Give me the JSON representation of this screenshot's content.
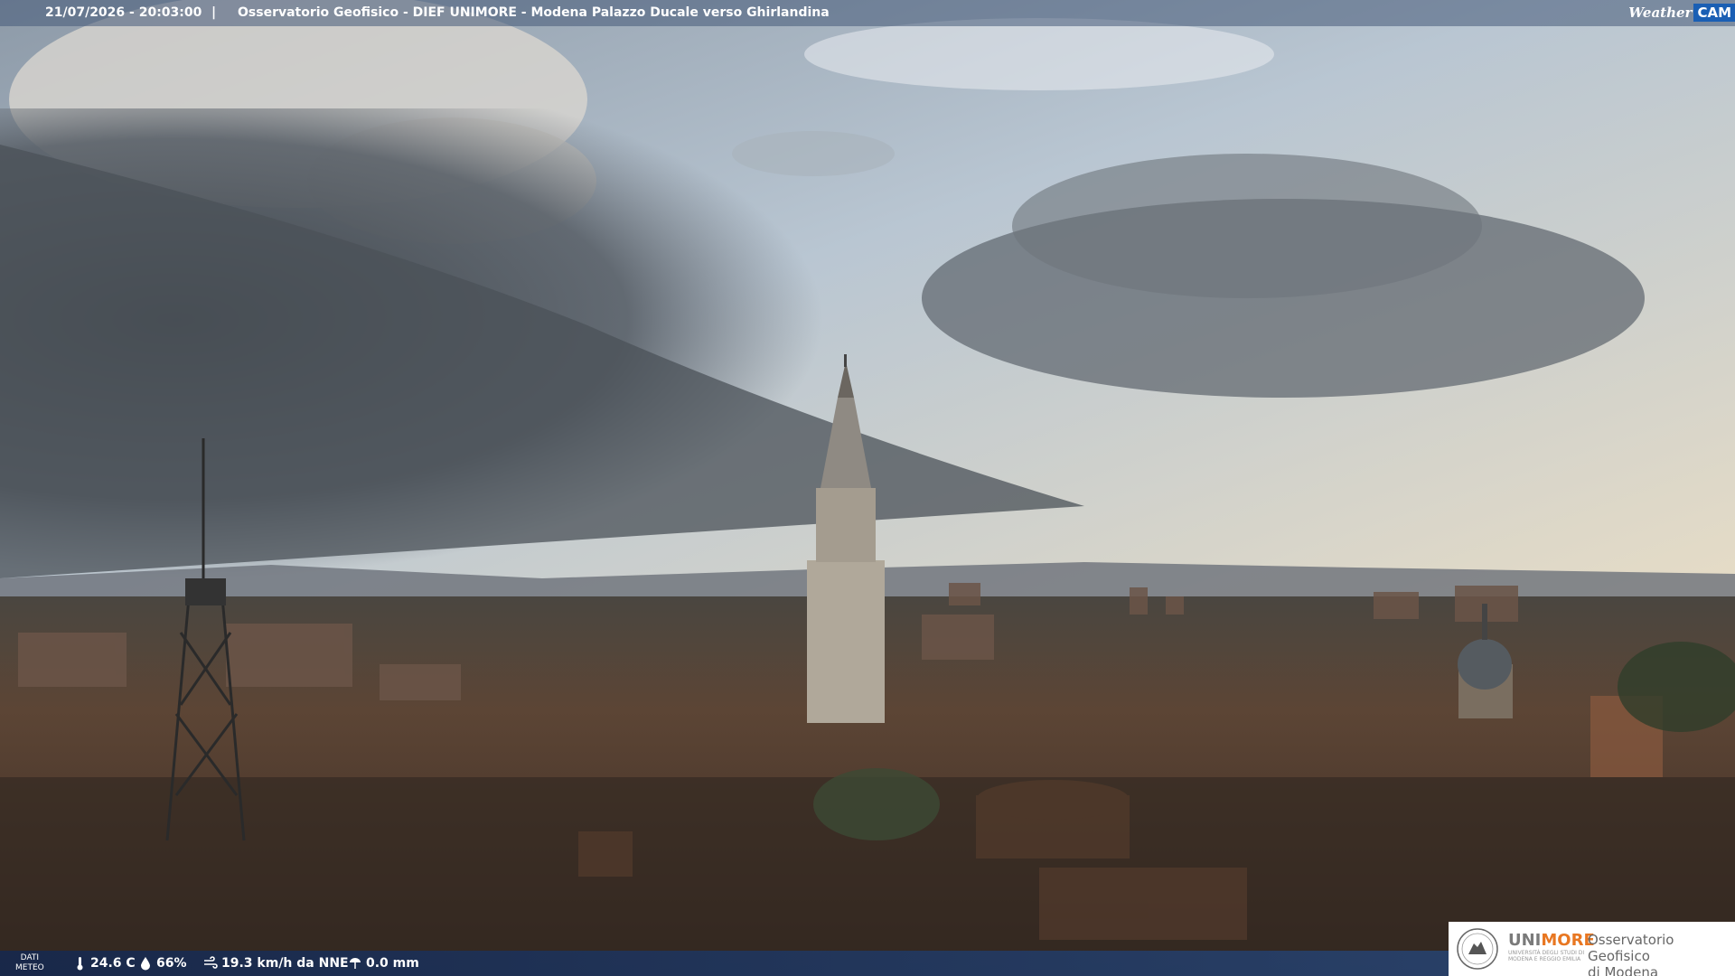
{
  "header": {
    "datetime": "21/07/2026 - 20:03:00",
    "separator": "|",
    "title": "Osservatorio Geofisico - DIEF UNIMORE - Modena Palazzo Ducale verso Ghirlandina",
    "brand_weather": "Weather",
    "brand_cam": "CAM"
  },
  "weather": {
    "label_line1": "DATI",
    "label_line2": "METEO",
    "temperature": "24.6 C",
    "humidity": "66%",
    "wind": "19.3 km/h da NNE",
    "rain": "0.0 mm"
  },
  "logo": {
    "uni_part1": "UNI",
    "uni_part2": "MORE",
    "uni_sub1": "UNIVERSITÀ DEGLI STUDI DI",
    "uni_sub2": "MODENA E REGGIO EMILIA",
    "observatory_line1": "Osservatorio Geofisico",
    "observatory_line2": "di Modena"
  },
  "colors": {
    "sky_top": "#9fb2c6",
    "storm": "#4a5056",
    "rooftops": "#5a3f2e",
    "accent_orange": "#e87722",
    "brand_blue": "#1a5fb4"
  }
}
